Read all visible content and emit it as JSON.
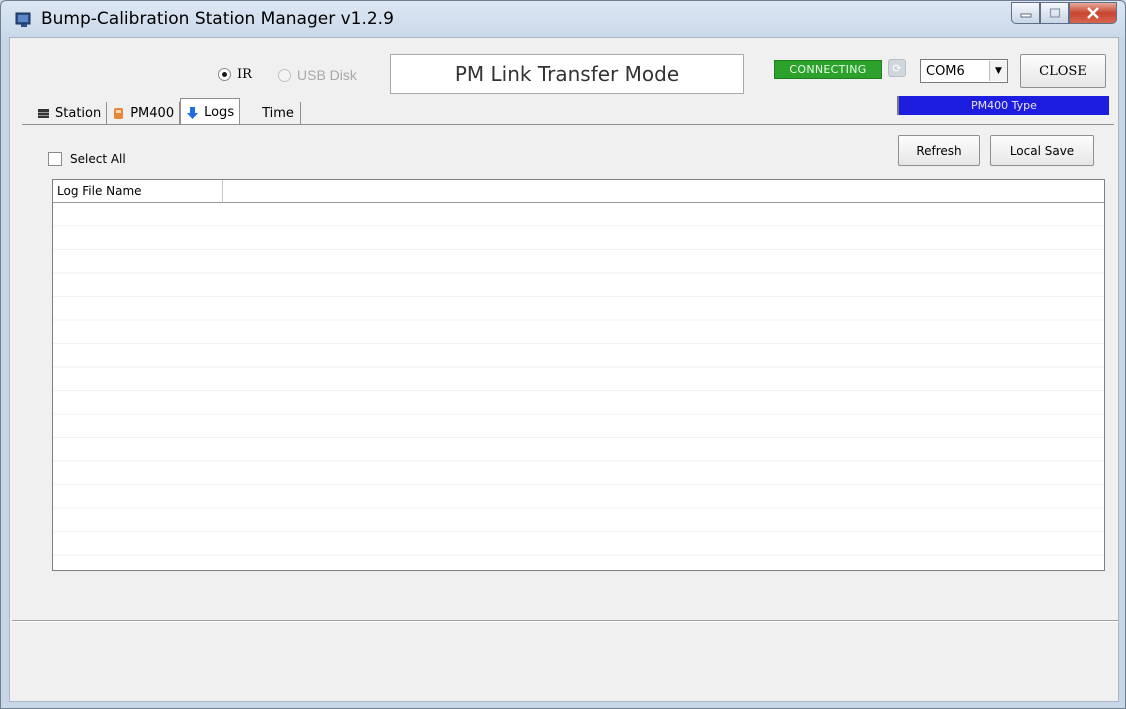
{
  "window": {
    "title": "Bump-Calibration Station Manager v1.2.9"
  },
  "connection": {
    "radio_ir_label": "IR",
    "radio_usb_label": "USB Disk",
    "mode_text": "PM Link Transfer Mode",
    "status_badge": "CONNECTING",
    "com_port": "COM6",
    "close_label": "CLOSE",
    "device_type": "PM400 Type"
  },
  "tabs": [
    {
      "label": "Station",
      "icon": "station-icon"
    },
    {
      "label": "PM400",
      "icon": "pm400-icon"
    },
    {
      "label": "Logs",
      "icon": "download-arrow-icon"
    },
    {
      "label": "Time",
      "icon": ""
    }
  ],
  "logs": {
    "select_all_label": "Select All",
    "refresh_label": "Refresh",
    "local_save_label": "Local Save",
    "columns": [
      "Log File Name",
      ""
    ],
    "rows": []
  },
  "colors": {
    "status_green": "#2ca12c",
    "type_blue": "#1d1de0"
  }
}
